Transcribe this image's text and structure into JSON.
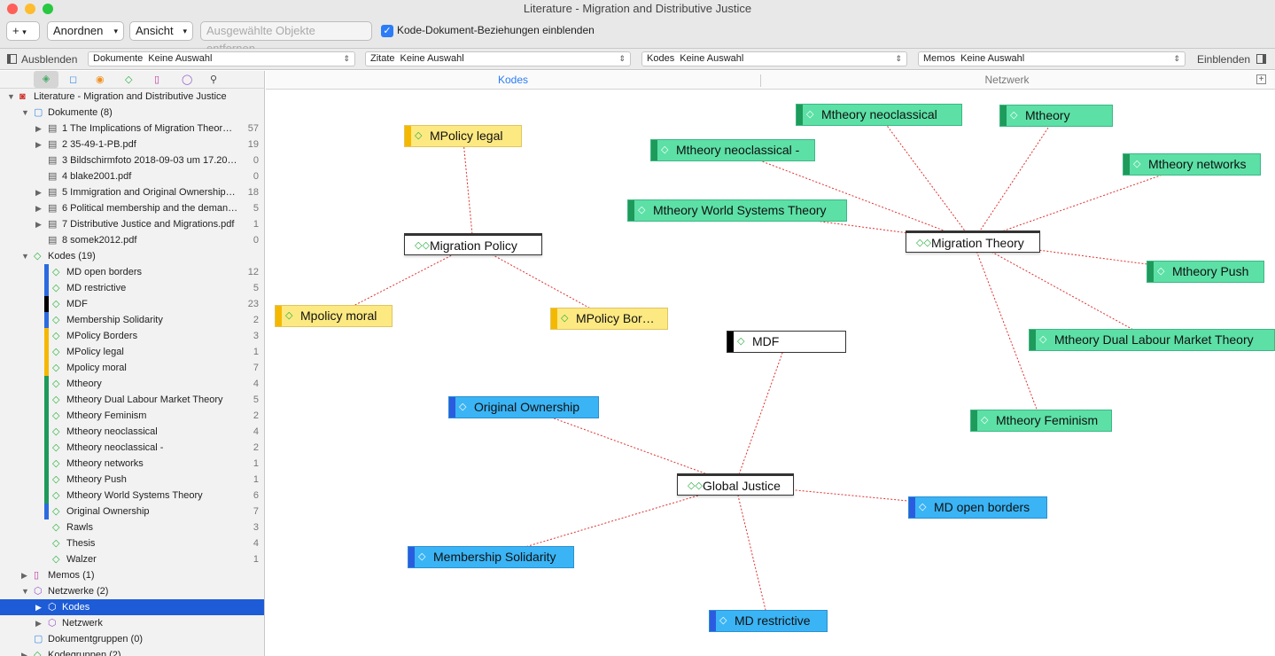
{
  "window": {
    "title": "Literature - Migration and Distributive Justice"
  },
  "toolbar": {
    "add_label": "+",
    "arrange_label": "Anordnen",
    "view_label": "Ansicht",
    "remove_label": "Ausgewählte Objekte entfernen",
    "show_relations_label": "Kode-Dokument-Beziehungen einblenden",
    "show_relations_checked": true
  },
  "filterbar": {
    "hide_label": "Ausblenden",
    "show_label": "Einblenden",
    "documents": {
      "name": "Dokumente",
      "value": "Keine Auswahl"
    },
    "quotes": {
      "name": "Zitate",
      "value": "Keine Auswahl"
    },
    "codes": {
      "name": "Kodes",
      "value": "Keine Auswahl"
    },
    "memos": {
      "name": "Memos",
      "value": "Keine Auswahl"
    }
  },
  "tabs": {
    "codes": "Kodes",
    "network": "Netzwerk",
    "active": "codes"
  },
  "sidebar": {
    "project": "Literature - Migration and Distributive Justice",
    "documents_group": "Dokumente (8)",
    "documents": [
      {
        "label": "1 The Implications of Migration Theor…",
        "count": "57"
      },
      {
        "label": "2 35-49-1-PB.pdf",
        "count": "19"
      },
      {
        "label": "3 Bildschirmfoto 2018-09-03 um 17.20…",
        "count": "0"
      },
      {
        "label": "4 blake2001.pdf",
        "count": "0"
      },
      {
        "label": "5 Immigration and Original Ownership…",
        "count": "18"
      },
      {
        "label": "6 Political membership and the deman…",
        "count": "5"
      },
      {
        "label": "7 Distributive Justice and Migrations.pdf",
        "count": "1"
      },
      {
        "label": "8 somek2012.pdf",
        "count": "0"
      }
    ],
    "codes_group": "Kodes (19)",
    "codes": [
      {
        "label": "MD open borders",
        "count": "12",
        "color": "#2b6be0"
      },
      {
        "label": "MD restrictive",
        "count": "5",
        "color": "#2b6be0"
      },
      {
        "label": "MDF",
        "count": "23",
        "color": "#000000"
      },
      {
        "label": "Membership Solidarity",
        "count": "2",
        "color": "#2b6be0"
      },
      {
        "label": "MPolicy Borders",
        "count": "3",
        "color": "#f5b800"
      },
      {
        "label": "MPolicy legal",
        "count": "1",
        "color": "#f5b800"
      },
      {
        "label": "Mpolicy moral",
        "count": "7",
        "color": "#f5b800"
      },
      {
        "label": "Mtheory",
        "count": "4",
        "color": "#1e9a5a"
      },
      {
        "label": "Mtheory Dual Labour Market Theory",
        "count": "5",
        "color": "#1e9a5a"
      },
      {
        "label": "Mtheory Feminism",
        "count": "2",
        "color": "#1e9a5a"
      },
      {
        "label": "Mtheory neoclassical",
        "count": "4",
        "color": "#1e9a5a"
      },
      {
        "label": "Mtheory neoclassical -",
        "count": "2",
        "color": "#1e9a5a"
      },
      {
        "label": "Mtheory networks",
        "count": "1",
        "color": "#1e9a5a"
      },
      {
        "label": "Mtheory Push",
        "count": "1",
        "color": "#1e9a5a"
      },
      {
        "label": "Mtheory World Systems Theory",
        "count": "6",
        "color": "#1e9a5a"
      },
      {
        "label": "Original Ownership",
        "count": "7",
        "color": "#2b6be0"
      },
      {
        "label": "Rawls",
        "count": "3",
        "color": ""
      },
      {
        "label": "Thesis",
        "count": "4",
        "color": ""
      },
      {
        "label": "Walzer",
        "count": "1",
        "color": ""
      }
    ],
    "memos": "Memos (1)",
    "networks_group": "Netzwerke (2)",
    "networks": [
      {
        "label": "Kodes",
        "selected": true
      },
      {
        "label": "Netzwerk",
        "selected": false
      }
    ],
    "docgroups": "Dokumentgruppen (0)",
    "codegroups": "Kodegruppen (2)"
  },
  "network": {
    "colors": {
      "yellow": "#fde982",
      "yellow_bar": "#f5b800",
      "green": "#5ce0a6",
      "green_bar": "#1e9a5a",
      "blue": "#3ab4f5",
      "blue_bar": "#2b5ce0",
      "edge": "#e03030"
    },
    "hubs": [
      {
        "id": "migration-policy",
        "label": "Migration Policy"
      },
      {
        "id": "migration-theory",
        "label": "Migration Theory"
      },
      {
        "id": "global-justice",
        "label": "Global Justice"
      }
    ],
    "nodes": [
      {
        "id": "mpolicy-legal",
        "label": "MPolicy legal",
        "kind": "yellow"
      },
      {
        "id": "mpolicy-moral",
        "label": "Mpolicy moral",
        "kind": "yellow"
      },
      {
        "id": "mpolicy-borders",
        "label": "MPolicy Bor…",
        "kind": "yellow"
      },
      {
        "id": "mtheory-neoclassical",
        "label": "Mtheory neoclassical",
        "kind": "green"
      },
      {
        "id": "mtheory",
        "label": "Mtheory",
        "kind": "green"
      },
      {
        "id": "mtheory-neoclassical-dash",
        "label": "Mtheory neoclassical -",
        "kind": "green"
      },
      {
        "id": "mtheory-networks",
        "label": "Mtheory networks",
        "kind": "green"
      },
      {
        "id": "mtheory-world",
        "label": "Mtheory World Systems Theory",
        "kind": "green"
      },
      {
        "id": "mtheory-push",
        "label": "Mtheory Push",
        "kind": "green"
      },
      {
        "id": "mtheory-dual",
        "label": "Mtheory Dual Labour Market Theory",
        "kind": "green"
      },
      {
        "id": "mtheory-feminism",
        "label": "Mtheory Feminism",
        "kind": "green"
      },
      {
        "id": "mdf",
        "label": "MDF",
        "kind": "black"
      },
      {
        "id": "original-ownership",
        "label": "Original Ownership",
        "kind": "blue"
      },
      {
        "id": "md-open-borders",
        "label": "MD open borders",
        "kind": "blue"
      },
      {
        "id": "membership-solidarity",
        "label": "Membership Solidarity",
        "kind": "blue"
      },
      {
        "id": "md-restrictive",
        "label": "MD restrictive",
        "kind": "blue"
      }
    ],
    "edges": [
      [
        "migration-policy",
        "mpolicy-legal"
      ],
      [
        "migration-policy",
        "mpolicy-moral"
      ],
      [
        "migration-policy",
        "mpolicy-borders"
      ],
      [
        "migration-theory",
        "mtheory-neoclassical"
      ],
      [
        "migration-theory",
        "mtheory"
      ],
      [
        "migration-theory",
        "mtheory-neoclassical-dash"
      ],
      [
        "migration-theory",
        "mtheory-networks"
      ],
      [
        "migration-theory",
        "mtheory-world"
      ],
      [
        "migration-theory",
        "mtheory-push"
      ],
      [
        "migration-theory",
        "mtheory-dual"
      ],
      [
        "migration-theory",
        "mtheory-feminism"
      ],
      [
        "global-justice",
        "mdf"
      ],
      [
        "global-justice",
        "original-ownership"
      ],
      [
        "global-justice",
        "md-open-borders"
      ],
      [
        "global-justice",
        "membership-solidarity"
      ],
      [
        "global-justice",
        "md-restrictive"
      ]
    ]
  }
}
